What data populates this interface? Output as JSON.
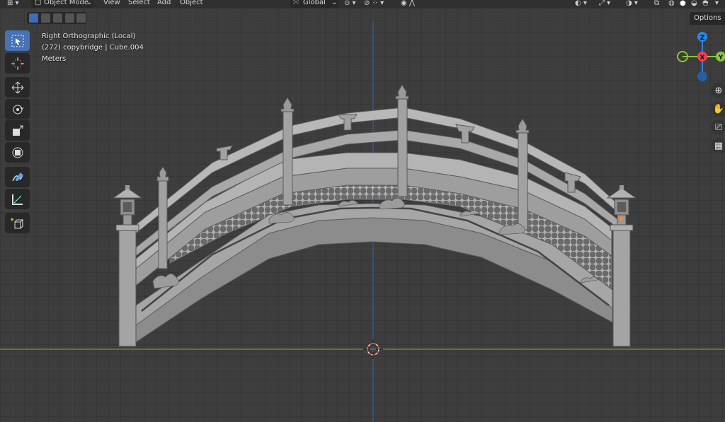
{
  "header": {
    "mode_label": "Object Mode",
    "menu": [
      "View",
      "Select",
      "Add",
      "Object"
    ],
    "orientation_label": "Global"
  },
  "viewport_info": {
    "view_name": "Right Orthographic (Local)",
    "object_line": "(272) copybridge | Cube.004",
    "units": "Meters"
  },
  "options_label": "Options",
  "gizmo": {
    "z_label": "Z",
    "x_label": "X",
    "y_label": "Y"
  },
  "toolbar": [
    "select-box",
    "cursor",
    "move",
    "rotate",
    "scale",
    "transform",
    "annotate",
    "measure",
    "add-cube"
  ],
  "colors": {
    "accent": "#4772b3",
    "axis_x": "#f33f54",
    "axis_y": "#8bc53f",
    "axis_z": "#2f84e3",
    "horizon_line": "#6b9a2e",
    "vertical_axis": "#2b5fa5"
  }
}
